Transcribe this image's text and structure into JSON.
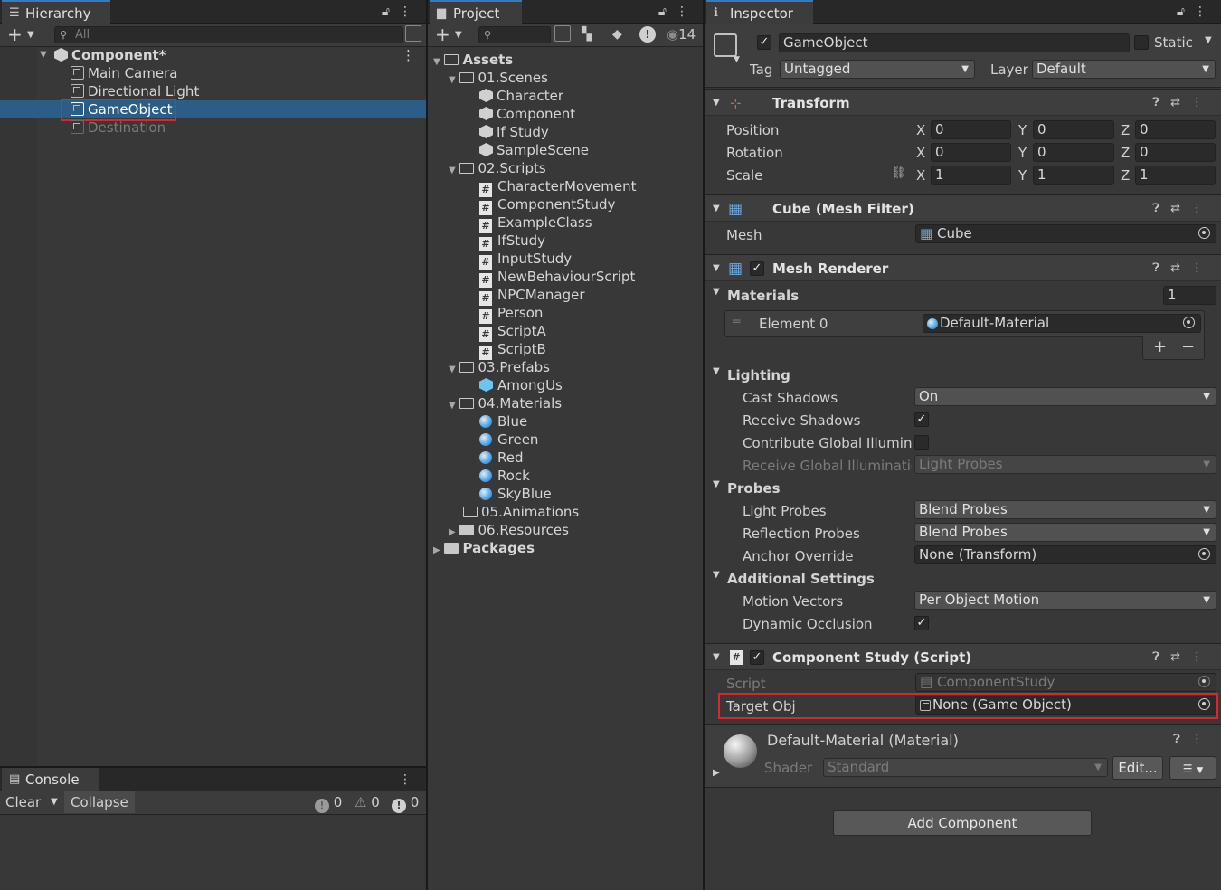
{
  "hierarchy": {
    "tab_label": "Hierarchy",
    "search_placeholder": "All",
    "scene": "Component*",
    "items": [
      "Main Camera",
      "Directional Light",
      "GameObject",
      "Destination"
    ]
  },
  "project": {
    "tab_label": "Project",
    "hidden_count": "14",
    "tree": {
      "assets": "Assets",
      "scenes_folder": "01.Scenes",
      "scenes": [
        "Character",
        "Component",
        "If Study",
        "SampleScene"
      ],
      "scripts_folder": "02.Scripts",
      "scripts": [
        "CharacterMovement",
        "ComponentStudy",
        "ExampleClass",
        "IfStudy",
        "InputStudy",
        "NewBehaviourScript",
        "NPCManager",
        "Person",
        "ScriptA",
        "ScriptB"
      ],
      "prefabs_folder": "03.Prefabs",
      "prefabs": [
        "AmongUs"
      ],
      "materials_folder": "04.Materials",
      "materials": [
        "Blue",
        "Green",
        "Red",
        "Rock",
        "SkyBlue"
      ],
      "animations_folder": "05.Animations",
      "resources_folder": "06.Resources",
      "packages": "Packages"
    }
  },
  "console": {
    "tab_label": "Console",
    "clear_label": "Clear",
    "collapse_label": "Collapse",
    "info_count": "0",
    "warning_count": "0",
    "error_count": "0"
  },
  "inspector": {
    "tab_label": "Inspector",
    "object_name": "GameObject",
    "static_label": "Static",
    "tag_label": "Tag",
    "tag_value": "Untagged",
    "layer_label": "Layer",
    "layer_value": "Default",
    "transform": {
      "title": "Transform",
      "position_label": "Position",
      "rotation_label": "Rotation",
      "scale_label": "Scale",
      "axis_x": "X",
      "axis_y": "Y",
      "axis_z": "Z",
      "position": [
        "0",
        "0",
        "0"
      ],
      "rotation": [
        "0",
        "0",
        "0"
      ],
      "scale": [
        "1",
        "1",
        "1"
      ]
    },
    "mesh_filter": {
      "title": "Cube (Mesh Filter)",
      "mesh_label": "Mesh",
      "mesh_value": "Cube"
    },
    "mesh_renderer": {
      "title": "Mesh Renderer",
      "materials_label": "Materials",
      "materials_count": "1",
      "element0_label": "Element 0",
      "element0_value": "Default-Material",
      "lighting_label": "Lighting",
      "cast_shadows_label": "Cast Shadows",
      "cast_shadows_value": "On",
      "receive_shadows_label": "Receive Shadows",
      "contribute_gi_label": "Contribute Global Illuminat",
      "receive_gi_label": "Receive Global Illuminatio",
      "receive_gi_value": "Light Probes",
      "probes_label": "Probes",
      "light_probes_label": "Light Probes",
      "light_probes_value": "Blend Probes",
      "reflection_probes_label": "Reflection Probes",
      "reflection_probes_value": "Blend Probes",
      "anchor_override_label": "Anchor Override",
      "anchor_override_value": "None (Transform)",
      "additional_label": "Additional Settings",
      "motion_vectors_label": "Motion Vectors",
      "motion_vectors_value": "Per Object Motion",
      "dynamic_occlusion_label": "Dynamic Occlusion"
    },
    "component_study": {
      "title": "Component Study (Script)",
      "script_label": "Script",
      "script_value": "ComponentStudy",
      "target_label": "Target Obj",
      "target_value": "None (Game Object)"
    },
    "material": {
      "title": "Default-Material (Material)",
      "shader_label": "Shader",
      "shader_value": "Standard",
      "edit_label": "Edit..."
    },
    "add_component_label": "Add Component"
  },
  "colors": {
    "selection": "#2c5d87",
    "highlight_box": "#e0242a",
    "panel_bg": "#383838"
  }
}
